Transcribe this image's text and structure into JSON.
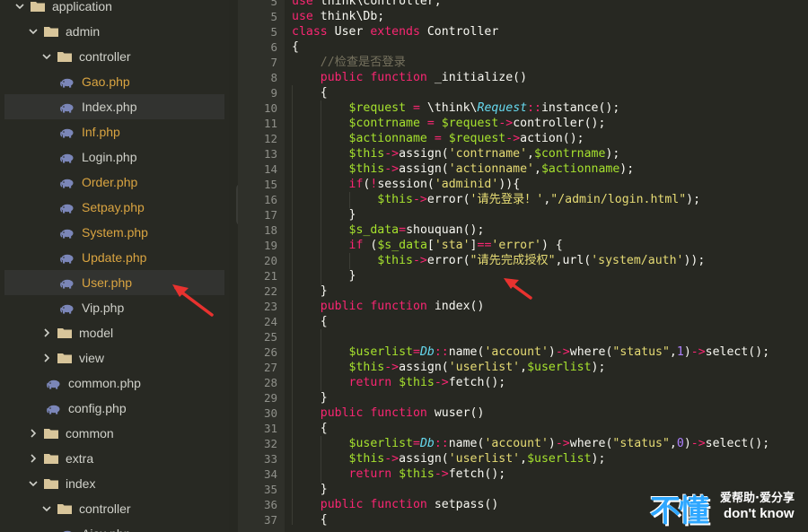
{
  "sidebar": {
    "tree": [
      {
        "label": "application",
        "type": "folder",
        "expanded": true,
        "depth": 0
      },
      {
        "label": "admin",
        "type": "folder",
        "expanded": true,
        "depth": 1
      },
      {
        "label": "controller",
        "type": "folder",
        "expanded": true,
        "depth": 2
      },
      {
        "label": "Gao.php",
        "type": "php",
        "depth": 3,
        "modified": true
      },
      {
        "label": "Index.php",
        "type": "php",
        "depth": 3,
        "modified": false,
        "highlighted": true
      },
      {
        "label": "Inf.php",
        "type": "php",
        "depth": 3,
        "modified": true
      },
      {
        "label": "Login.php",
        "type": "php",
        "depth": 3,
        "modified": false
      },
      {
        "label": "Order.php",
        "type": "php",
        "depth": 3,
        "modified": true
      },
      {
        "label": "Setpay.php",
        "type": "php",
        "depth": 3,
        "modified": true
      },
      {
        "label": "System.php",
        "type": "php",
        "depth": 3,
        "modified": true
      },
      {
        "label": "Update.php",
        "type": "php",
        "depth": 3,
        "modified": true
      },
      {
        "label": "User.php",
        "type": "php",
        "depth": 3,
        "modified": true,
        "selected": true
      },
      {
        "label": "Vip.php",
        "type": "php",
        "depth": 3,
        "modified": false
      },
      {
        "label": "model",
        "type": "folder",
        "expanded": false,
        "depth": 2
      },
      {
        "label": "view",
        "type": "folder",
        "expanded": false,
        "depth": 2
      },
      {
        "label": "common.php",
        "type": "php",
        "depth": 2,
        "modified": false
      },
      {
        "label": "config.php",
        "type": "php",
        "depth": 2,
        "modified": false
      },
      {
        "label": "common",
        "type": "folder",
        "expanded": false,
        "depth": 1
      },
      {
        "label": "extra",
        "type": "folder",
        "expanded": false,
        "depth": 1
      },
      {
        "label": "index",
        "type": "folder",
        "expanded": true,
        "depth": 1
      },
      {
        "label": "controller",
        "type": "folder",
        "expanded": true,
        "depth": 2
      },
      {
        "label": "Ajax.php",
        "type": "php",
        "depth": 3,
        "modified": false
      }
    ]
  },
  "editor": {
    "lines": [
      {
        "n": "5",
        "tokens": [
          [
            "kw",
            "use"
          ],
          [
            "plain",
            " think\\controller;"
          ]
        ]
      },
      {
        "n": "5",
        "tokens": [
          [
            "kw",
            "use"
          ],
          [
            "plain",
            " think\\Db;"
          ]
        ]
      },
      {
        "n": "5",
        "tokens": [
          [
            "kw",
            "class"
          ],
          [
            "plain",
            " User "
          ],
          [
            "kw",
            "extends"
          ],
          [
            "plain",
            " Controller"
          ]
        ]
      },
      {
        "n": "6",
        "tokens": [
          [
            "plain",
            "{"
          ]
        ]
      },
      {
        "n": "7",
        "tokens": [
          [
            "plain",
            "    "
          ],
          [
            "cmt",
            "//检查是否登录"
          ]
        ]
      },
      {
        "n": "8",
        "tokens": [
          [
            "plain",
            "    "
          ],
          [
            "kw",
            "public"
          ],
          [
            "plain",
            " "
          ],
          [
            "kw",
            "function"
          ],
          [
            "plain",
            " _initialize()"
          ]
        ]
      },
      {
        "n": "9",
        "tokens": [
          [
            "plain",
            "    {"
          ]
        ]
      },
      {
        "n": "10",
        "tokens": [
          [
            "plain",
            "        "
          ],
          [
            "var",
            "$request"
          ],
          [
            "plain",
            " "
          ],
          [
            "op",
            "="
          ],
          [
            "plain",
            " \\think\\"
          ],
          [
            "cls",
            "Request"
          ],
          [
            "op",
            "::"
          ],
          [
            "plain",
            "instance();"
          ]
        ]
      },
      {
        "n": "11",
        "tokens": [
          [
            "plain",
            "        "
          ],
          [
            "var",
            "$contrname"
          ],
          [
            "plain",
            " "
          ],
          [
            "op",
            "="
          ],
          [
            "plain",
            " "
          ],
          [
            "var",
            "$request"
          ],
          [
            "op",
            "->"
          ],
          [
            "plain",
            "controller();"
          ]
        ]
      },
      {
        "n": "12",
        "tokens": [
          [
            "plain",
            "        "
          ],
          [
            "var",
            "$actionname"
          ],
          [
            "plain",
            " "
          ],
          [
            "op",
            "="
          ],
          [
            "plain",
            " "
          ],
          [
            "var",
            "$request"
          ],
          [
            "op",
            "->"
          ],
          [
            "plain",
            "action();"
          ]
        ]
      },
      {
        "n": "13",
        "tokens": [
          [
            "plain",
            "        "
          ],
          [
            "var",
            "$this"
          ],
          [
            "op",
            "->"
          ],
          [
            "plain",
            "assign("
          ],
          [
            "str",
            "'contrname'"
          ],
          [
            "plain",
            ","
          ],
          [
            "var",
            "$contrname"
          ],
          [
            "plain",
            ");"
          ]
        ]
      },
      {
        "n": "14",
        "tokens": [
          [
            "plain",
            "        "
          ],
          [
            "var",
            "$this"
          ],
          [
            "op",
            "->"
          ],
          [
            "plain",
            "assign("
          ],
          [
            "str",
            "'actionname'"
          ],
          [
            "plain",
            ","
          ],
          [
            "var",
            "$actionname"
          ],
          [
            "plain",
            ");"
          ]
        ]
      },
      {
        "n": "15",
        "tokens": [
          [
            "plain",
            "        "
          ],
          [
            "kw",
            "if"
          ],
          [
            "plain",
            "("
          ],
          [
            "op",
            "!"
          ],
          [
            "plain",
            "session("
          ],
          [
            "str",
            "'adminid'"
          ],
          [
            "plain",
            ")){"
          ]
        ]
      },
      {
        "n": "16",
        "tokens": [
          [
            "plain",
            "            "
          ],
          [
            "var",
            "$this"
          ],
          [
            "op",
            "->"
          ],
          [
            "plain",
            "error("
          ],
          [
            "str",
            "'请先登录！'"
          ],
          [
            "plain",
            ","
          ],
          [
            "str",
            "\"/admin/login.html\""
          ],
          [
            "plain",
            ");"
          ]
        ]
      },
      {
        "n": "17",
        "tokens": [
          [
            "plain",
            "        }"
          ]
        ]
      },
      {
        "n": "18",
        "tokens": [
          [
            "plain",
            "        "
          ],
          [
            "var",
            "$s_data"
          ],
          [
            "op",
            "="
          ],
          [
            "plain",
            "shouquan();"
          ]
        ]
      },
      {
        "n": "19",
        "tokens": [
          [
            "plain",
            "        "
          ],
          [
            "kw",
            "if"
          ],
          [
            "plain",
            " ("
          ],
          [
            "var",
            "$s_data"
          ],
          [
            "plain",
            "["
          ],
          [
            "str",
            "'sta'"
          ],
          [
            "plain",
            "]"
          ],
          [
            "op",
            "=="
          ],
          [
            "str",
            "'error'"
          ],
          [
            "plain",
            ") {"
          ]
        ]
      },
      {
        "n": "20",
        "tokens": [
          [
            "plain",
            "            "
          ],
          [
            "var",
            "$this"
          ],
          [
            "op",
            "->"
          ],
          [
            "plain",
            "error("
          ],
          [
            "str",
            "\"请先完成授权\""
          ],
          [
            "plain",
            ",url("
          ],
          [
            "str",
            "'system/auth'"
          ],
          [
            "plain",
            "));"
          ]
        ]
      },
      {
        "n": "21",
        "tokens": [
          [
            "plain",
            "        }"
          ]
        ]
      },
      {
        "n": "22",
        "tokens": [
          [
            "plain",
            "    }"
          ]
        ]
      },
      {
        "n": "23",
        "tokens": [
          [
            "plain",
            "    "
          ],
          [
            "kw",
            "public"
          ],
          [
            "plain",
            " "
          ],
          [
            "kw",
            "function"
          ],
          [
            "plain",
            " index()"
          ]
        ]
      },
      {
        "n": "24",
        "tokens": [
          [
            "plain",
            "    {"
          ]
        ]
      },
      {
        "n": "25",
        "tokens": [
          [
            "plain",
            ""
          ]
        ]
      },
      {
        "n": "26",
        "tokens": [
          [
            "plain",
            "        "
          ],
          [
            "var",
            "$userlist"
          ],
          [
            "op",
            "="
          ],
          [
            "cls",
            "Db"
          ],
          [
            "op",
            "::"
          ],
          [
            "plain",
            "name("
          ],
          [
            "str",
            "'account'"
          ],
          [
            "plain",
            ")"
          ],
          [
            "op",
            "->"
          ],
          [
            "plain",
            "where("
          ],
          [
            "str",
            "\"status\""
          ],
          [
            "plain",
            ","
          ],
          [
            "num",
            "1"
          ],
          [
            "plain",
            ")"
          ],
          [
            "op",
            "->"
          ],
          [
            "plain",
            "select();"
          ]
        ]
      },
      {
        "n": "27",
        "tokens": [
          [
            "plain",
            "        "
          ],
          [
            "var",
            "$this"
          ],
          [
            "op",
            "->"
          ],
          [
            "plain",
            "assign("
          ],
          [
            "str",
            "'userlist'"
          ],
          [
            "plain",
            ","
          ],
          [
            "var",
            "$userlist"
          ],
          [
            "plain",
            ");"
          ]
        ]
      },
      {
        "n": "28",
        "tokens": [
          [
            "plain",
            "        "
          ],
          [
            "kw",
            "return"
          ],
          [
            "plain",
            " "
          ],
          [
            "var",
            "$this"
          ],
          [
            "op",
            "->"
          ],
          [
            "plain",
            "fetch();"
          ]
        ]
      },
      {
        "n": "29",
        "tokens": [
          [
            "plain",
            "    }"
          ]
        ]
      },
      {
        "n": "30",
        "tokens": [
          [
            "plain",
            "    "
          ],
          [
            "kw",
            "public"
          ],
          [
            "plain",
            " "
          ],
          [
            "kw",
            "function"
          ],
          [
            "plain",
            " wuser()"
          ]
        ]
      },
      {
        "n": "31",
        "tokens": [
          [
            "plain",
            "    {"
          ]
        ]
      },
      {
        "n": "32",
        "tokens": [
          [
            "plain",
            "        "
          ],
          [
            "var",
            "$userlist"
          ],
          [
            "op",
            "="
          ],
          [
            "cls",
            "Db"
          ],
          [
            "op",
            "::"
          ],
          [
            "plain",
            "name("
          ],
          [
            "str",
            "'account'"
          ],
          [
            "plain",
            ")"
          ],
          [
            "op",
            "->"
          ],
          [
            "plain",
            "where("
          ],
          [
            "str",
            "\"status\""
          ],
          [
            "plain",
            ","
          ],
          [
            "num",
            "0"
          ],
          [
            "plain",
            ")"
          ],
          [
            "op",
            "->"
          ],
          [
            "plain",
            "select();"
          ]
        ]
      },
      {
        "n": "33",
        "tokens": [
          [
            "plain",
            "        "
          ],
          [
            "var",
            "$this"
          ],
          [
            "op",
            "->"
          ],
          [
            "plain",
            "assign("
          ],
          [
            "str",
            "'userlist'"
          ],
          [
            "plain",
            ","
          ],
          [
            "var",
            "$userlist"
          ],
          [
            "plain",
            ");"
          ]
        ]
      },
      {
        "n": "34",
        "tokens": [
          [
            "plain",
            "        "
          ],
          [
            "kw",
            "return"
          ],
          [
            "plain",
            " "
          ],
          [
            "var",
            "$this"
          ],
          [
            "op",
            "->"
          ],
          [
            "plain",
            "fetch();"
          ]
        ]
      },
      {
        "n": "35",
        "tokens": [
          [
            "plain",
            "    }"
          ]
        ]
      },
      {
        "n": "36",
        "tokens": [
          [
            "plain",
            "    "
          ],
          [
            "kw",
            "public"
          ],
          [
            "plain",
            " "
          ],
          [
            "kw",
            "function"
          ],
          [
            "plain",
            " setpass()"
          ]
        ]
      },
      {
        "n": "37",
        "tokens": [
          [
            "plain",
            "    {"
          ]
        ]
      }
    ]
  },
  "watermark": {
    "big": "不懂",
    "cn": "爱帮助·爱分享",
    "en": "don't know"
  },
  "colors": {
    "background": "#272822",
    "sidebar": "#282923",
    "keyword": "#f92672",
    "variable": "#a6e22e",
    "string": "#e6db74",
    "comment": "#75715e",
    "arrow": "#e8322f"
  }
}
